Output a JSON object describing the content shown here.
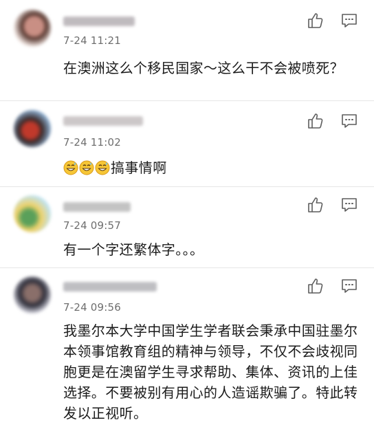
{
  "comments": [
    {
      "time": "7-24 11:21",
      "text": "在澳洲这么个移民国家～这么干不会被喷死？",
      "nick_color": "#b9b4b8",
      "avatar_colors": [
        "#f2e8e4",
        "#5b3b33",
        "#c98f84"
      ]
    },
    {
      "time": "7-24 11:02",
      "text": "搞事情啊",
      "emoji": "grinning-sweat-emoji",
      "emoji_count": 3,
      "nick_color": "#c7c2c3",
      "avatar_colors": [
        "#8fb3d6",
        "#c0392b",
        "#3a2a2a"
      ]
    },
    {
      "time": "7-24 09:57",
      "text": "有一个字还繁体字。。。",
      "nick_color": "#bdbdbd",
      "avatar_colors": [
        "#bfe3f2",
        "#f0d26a",
        "#5aa05a"
      ]
    },
    {
      "time": "7-24 09:56",
      "text": "我墨尔本大学中国学生学者联会秉承中国驻墨尔本领事馆教育组的精神与领导，不仅不会歧视同胞更是在澳留学生寻求帮助、集体、资讯的上佳选择。不要被别有用心的人造谣欺骗了。特此转发以正视听。",
      "nick_color": "#b8b8bc",
      "avatar_colors": [
        "#dcdce6",
        "#2e2e3a",
        "#8a6f6a"
      ]
    }
  ],
  "icons": {
    "like": "thumbs-up-icon",
    "comment": "comment-bubble-icon"
  },
  "colors": {
    "icon_stroke": "#5c5c5c",
    "divider": "#e6e6e6",
    "time_text": "#6e6e6e"
  }
}
